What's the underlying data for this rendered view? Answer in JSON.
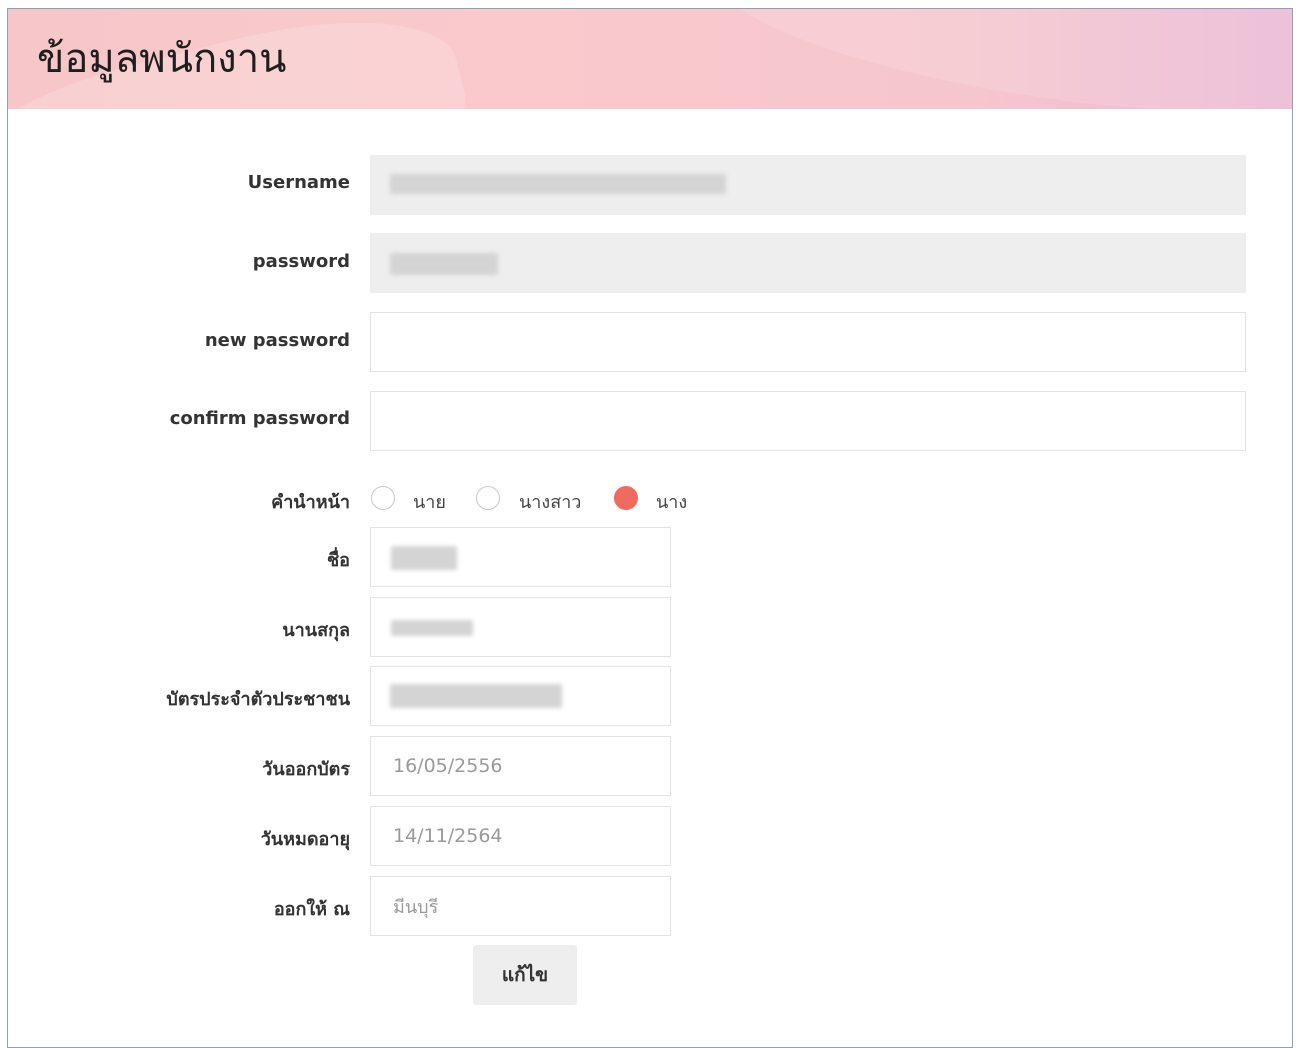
{
  "page": {
    "title": "ข้อมูลพนักงาน"
  },
  "form": {
    "username": {
      "label": "Username",
      "value": ""
    },
    "password": {
      "label": "password",
      "value": ""
    },
    "new_password": {
      "label": "new password",
      "value": ""
    },
    "confirm_password": {
      "label": "confirm password",
      "value": ""
    },
    "title_prefix": {
      "label": "คำนำหน้า",
      "options": [
        "นาย",
        "นางสาว",
        "นาง"
      ],
      "selected": "นาง"
    },
    "first_name": {
      "label": "ชื่อ",
      "value": ""
    },
    "last_name": {
      "label": "นานสกุล",
      "value": ""
    },
    "id_card": {
      "label": "บัตรประจำตัวประชาชน",
      "value": ""
    },
    "issue_date": {
      "label": "วันออกบัตร",
      "value": "16/05/2556"
    },
    "expiry_date": {
      "label": "วันหมดอายุ",
      "value": "14/11/2564"
    },
    "issued_at": {
      "label": "ออกให้ ณ",
      "value": "มีนบุรี"
    },
    "submit_label": "แก้ไข"
  },
  "colors": {
    "header_pink": "#f7c6c9",
    "radio_selected": "#f06a5e",
    "readonly_bg": "#eeeeee",
    "border_blue": "#8aa0bf"
  }
}
